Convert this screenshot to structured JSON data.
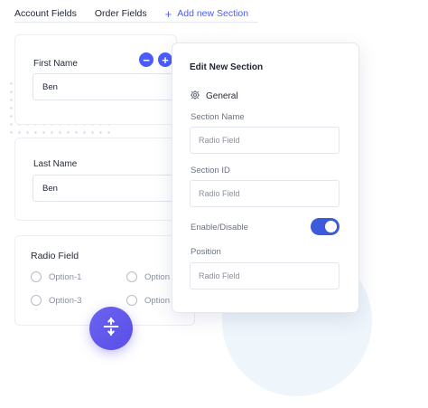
{
  "tabs": {
    "account": "Account Fields",
    "order": "Order Fields",
    "add_new": "Add new Section",
    "add_icon": "plus-icon"
  },
  "first_name": {
    "label": "First Name",
    "value": "Ben",
    "remove_icon": "minus-icon",
    "add_icon": "plus-icon"
  },
  "last_name": {
    "label": "Last Name",
    "value": "Ben"
  },
  "radio_field": {
    "title": "Radio Field",
    "options": [
      "Option-1",
      "Option",
      "Option-3",
      "Option"
    ]
  },
  "fab": {
    "icon": "expand-vertical-icon",
    "color": "#5b4ee6"
  },
  "panel": {
    "title": "Edit New Section",
    "general_label": "General",
    "general_icon": "gear-icon",
    "section_name": {
      "label": "Section Name",
      "placeholder": "Radio Field"
    },
    "section_id": {
      "label": "Section ID",
      "placeholder": "Radio Field"
    },
    "enable": {
      "label": "Enable/Disable",
      "on": true
    },
    "position": {
      "label": "Position",
      "placeholder": "Radio Field"
    }
  },
  "colors": {
    "accent": "#4a5cff",
    "toggle": "#3b5bdb"
  }
}
